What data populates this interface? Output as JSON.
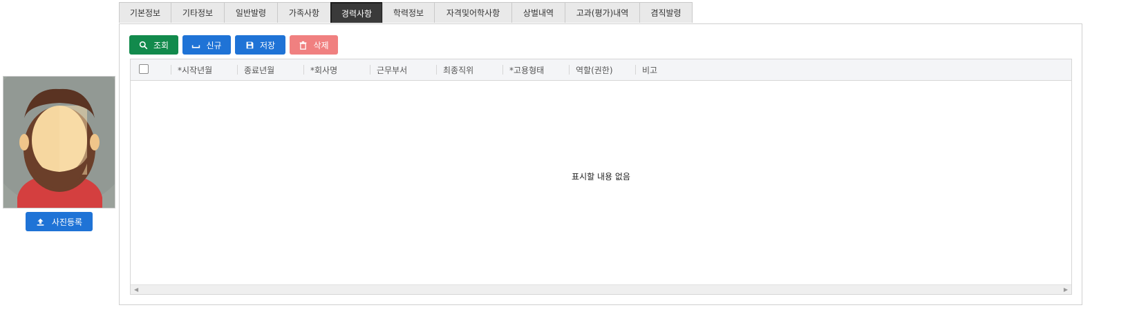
{
  "photo": {
    "upload_label": "사진등록",
    "icon": "upload-icon"
  },
  "tabs": [
    {
      "label": "기본정보",
      "active": false
    },
    {
      "label": "기타정보",
      "active": false
    },
    {
      "label": "일반발령",
      "active": false
    },
    {
      "label": "가족사항",
      "active": false
    },
    {
      "label": "경력사항",
      "active": true
    },
    {
      "label": "학력정보",
      "active": false
    },
    {
      "label": "자격및어학사항",
      "active": false
    },
    {
      "label": "상벌내역",
      "active": false
    },
    {
      "label": "고과(평가)내역",
      "active": false
    },
    {
      "label": "겸직발령",
      "active": false
    }
  ],
  "toolbar": {
    "search_label": "조회",
    "new_label": "신규",
    "save_label": "저장",
    "delete_label": "삭제"
  },
  "grid": {
    "columns": [
      "*시작년월",
      "종료년월",
      "*회사명",
      "근무부서",
      "최종직위",
      "*고용형태",
      "역할(권한)",
      "비고"
    ],
    "empty_text": "표시할 내용 없음"
  },
  "colors": {
    "search_button": "#128a4c",
    "primary_button": "#1f73d6",
    "delete_button": "#f08080",
    "active_tab": "#3a3a3a"
  }
}
